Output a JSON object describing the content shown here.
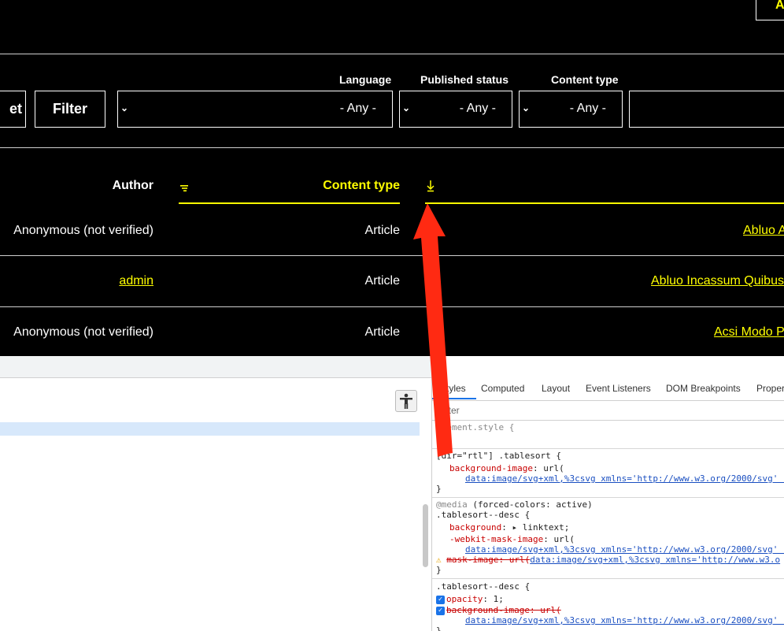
{
  "top_button": {
    "label": "A"
  },
  "filters": {
    "reset_label": "et",
    "filter_label": "Filter",
    "language": {
      "label": "Language",
      "value": "- Any -"
    },
    "published_status": {
      "label": "Published status",
      "value": "- Any -"
    },
    "content_type": {
      "label": "Content type",
      "value": "- Any -"
    }
  },
  "table": {
    "headers": {
      "author": "Author",
      "content_type": "Content type"
    },
    "rows": [
      {
        "author": "Anonymous (not verified)",
        "type": "Article",
        "title": "Abluo A"
      },
      {
        "author": "admin",
        "type": "Article",
        "title": "Abluo Incassum Quibus"
      },
      {
        "author": "Anonymous (not verified)",
        "type": "Article",
        "title": "Acsi Modo P"
      }
    ]
  },
  "devtools": {
    "tabs": [
      "Styles",
      "Computed",
      "Layout",
      "Event Listeners",
      "DOM Breakpoints",
      "Proper"
    ],
    "filter_placeholder": "Filter",
    "rules": {
      "r1_sel": "element.style {",
      "r1_close": "}",
      "r2_sel": "[dir=\"rtl\"] .tablesort {",
      "r2_prop": "background-image",
      "r2_val": ": url(",
      "r2_url": "data:image/svg+xml,%3csvg xmlns='http://www.w3.org/2000/svg' (",
      "r2_close": "}",
      "r3_media_kw": "@media",
      "r3_media": " (forced-colors: active)",
      "r3_sel": ".tablesort--desc {",
      "r3_p1": "background",
      "r3_v1": ": ▸ linktext;",
      "r3_p2": "-webkit-mask-image",
      "r3_v2": ": url(",
      "r3_url2": "data:image/svg+xml,%3csvg xmlns='http://www.w3.org/2000/svg' (",
      "r3_p3": "mask-image: url(",
      "r3_url3": "data:image/svg+xml,%3csvg xmlns='http://www.w3.o",
      "r3_close": "}",
      "r4_sel": ".tablesort--desc {",
      "r4_p1": "opacity",
      "r4_v1": ": 1;",
      "r4_p2": "background-image: url(",
      "r4_url": "data:image/svg+xml,%3csvg xmlns='http://www.w3.org/2000/svg' (",
      "r4_close": "}"
    }
  },
  "colors": {
    "accent": "#ffff00",
    "arrow": "#ff2a12",
    "link_blue": "#1a4fc1",
    "selection": "#d7e8fb"
  }
}
